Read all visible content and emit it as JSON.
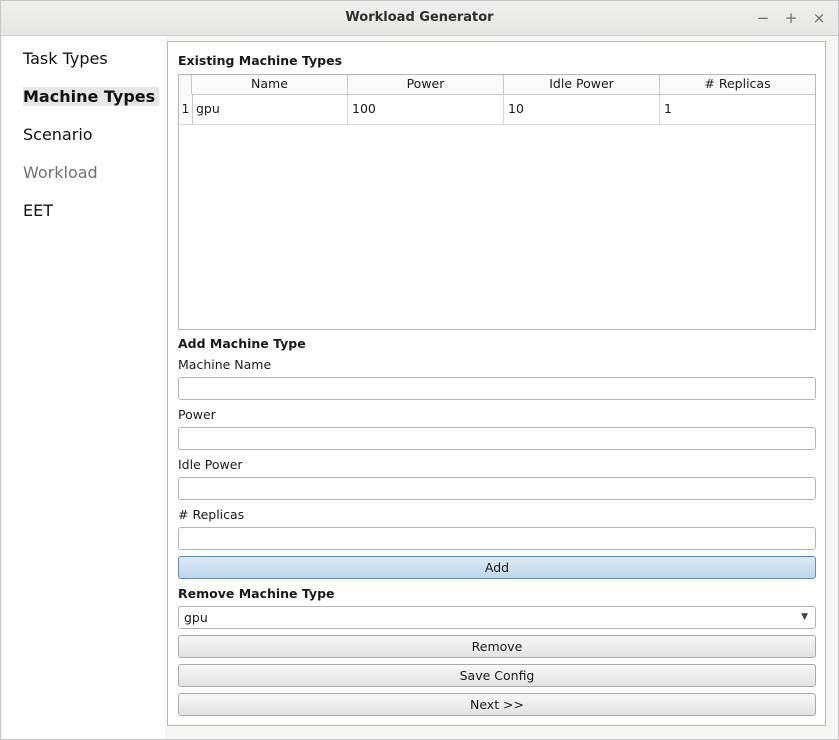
{
  "window": {
    "title": "Workload Generator",
    "minimize": "−",
    "maximize": "+",
    "close": "×"
  },
  "sidebar": {
    "items": [
      {
        "label": "Task Types"
      },
      {
        "label": "Machine Types"
      },
      {
        "label": "Scenario"
      },
      {
        "label": "Workload"
      },
      {
        "label": "EET"
      }
    ]
  },
  "existing": {
    "title": "Existing Machine Types",
    "columns": [
      "Name",
      "Power",
      "Idle Power",
      "# Replicas"
    ],
    "rows": [
      {
        "index": "1",
        "name": "gpu",
        "power": "100",
        "idle_power": "10",
        "replicas": "1"
      }
    ]
  },
  "add": {
    "title": "Add Machine Type",
    "machine_name_label": "Machine Name",
    "machine_name_value": "",
    "power_label": "Power",
    "power_value": "",
    "idle_power_label": "Idle Power",
    "idle_power_value": "",
    "replicas_label": "# Replicas",
    "replicas_value": "",
    "add_button": "Add"
  },
  "remove": {
    "title": "Remove Machine Type",
    "selected": "gpu",
    "remove_button": "Remove"
  },
  "footer": {
    "save_button": "Save Config",
    "next_button": "Next >>"
  }
}
